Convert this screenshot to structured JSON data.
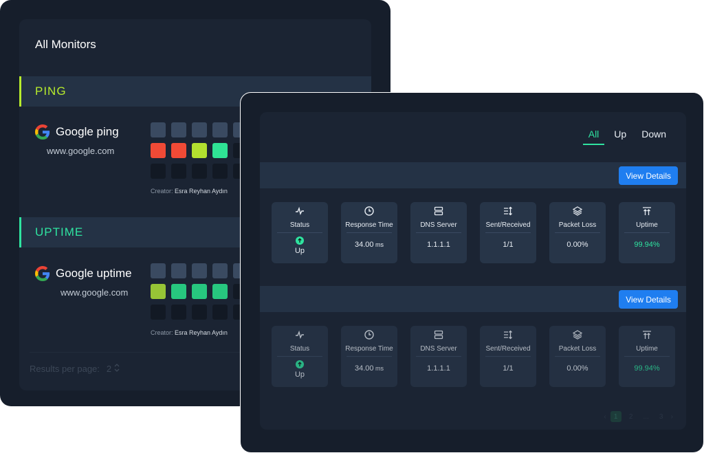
{
  "back": {
    "title": "All Monitors",
    "categories": [
      {
        "label": "PING",
        "monitor": {
          "name": "Google ping",
          "url": "www.google.com",
          "creator_prefix": "Creator:",
          "creator_name": "Esra Reyhan Aydın",
          "rows": [
            [
              "gray",
              "gray",
              "gray",
              "gray",
              "gray"
            ],
            [
              "red",
              "red",
              "lime",
              "green",
              "dark"
            ],
            [
              "dark",
              "dark",
              "dark",
              "dark",
              "dark"
            ]
          ]
        }
      },
      {
        "label": "UPTIME",
        "monitor": {
          "name": "Google uptime",
          "url": "www.google.com",
          "creator_prefix": "Creator:",
          "creator_name": "Esra Reyhan Aydın",
          "rows": [
            [
              "gray",
              "gray",
              "gray",
              "gray",
              "gray"
            ],
            [
              "olive",
              "green2",
              "green2",
              "green2",
              "dark"
            ],
            [
              "dark",
              "dark",
              "dark",
              "dark",
              "dark"
            ]
          ]
        }
      }
    ],
    "results_label": "Results per page:",
    "results_value": "2"
  },
  "front": {
    "filters": [
      "All",
      "Up",
      "Down"
    ],
    "active_filter": "All",
    "view_details_label": "View Details",
    "monitors": [
      {
        "cards": {
          "status": {
            "title": "Status",
            "value": "Up",
            "icon": "pulse-icon"
          },
          "response_time": {
            "title": "Response Time",
            "value": "34.00",
            "unit": "ms",
            "icon": "clock-icon"
          },
          "dns_server": {
            "title": "DNS Server",
            "value": "1.1.1.1",
            "icon": "server-icon"
          },
          "sent_received": {
            "title": "Sent/Received",
            "value": "1/1",
            "icon": "sort-icon"
          },
          "packet_loss": {
            "title": "Packet Loss",
            "value": "0.00%",
            "icon": "layers-icon"
          },
          "uptime": {
            "title": "Uptime",
            "value": "99.94%",
            "icon": "uptime-icon"
          }
        }
      },
      {
        "cards": {
          "status": {
            "title": "Status",
            "value": "Up",
            "icon": "pulse-icon"
          },
          "response_time": {
            "title": "Response Time",
            "value": "34.00",
            "unit": "ms",
            "icon": "clock-icon"
          },
          "dns_server": {
            "title": "DNS Server",
            "value": "1.1.1.1",
            "icon": "server-icon"
          },
          "sent_received": {
            "title": "Sent/Received",
            "value": "1/1",
            "icon": "sort-icon"
          },
          "packet_loss": {
            "title": "Packet Loss",
            "value": "0.00%",
            "icon": "layers-icon"
          },
          "uptime": {
            "title": "Uptime",
            "value": "99.94%",
            "icon": "uptime-icon"
          }
        }
      }
    ],
    "pagination": {
      "current": "1",
      "pages": [
        "1",
        "2",
        "...",
        "3"
      ]
    }
  },
  "colors": {
    "ping_accent": "#b7ec2c",
    "uptime_accent": "#2fe3a0",
    "button_blue": "#1f7ef0",
    "status_red": "#f04a36",
    "status_green": "#2fe395"
  }
}
